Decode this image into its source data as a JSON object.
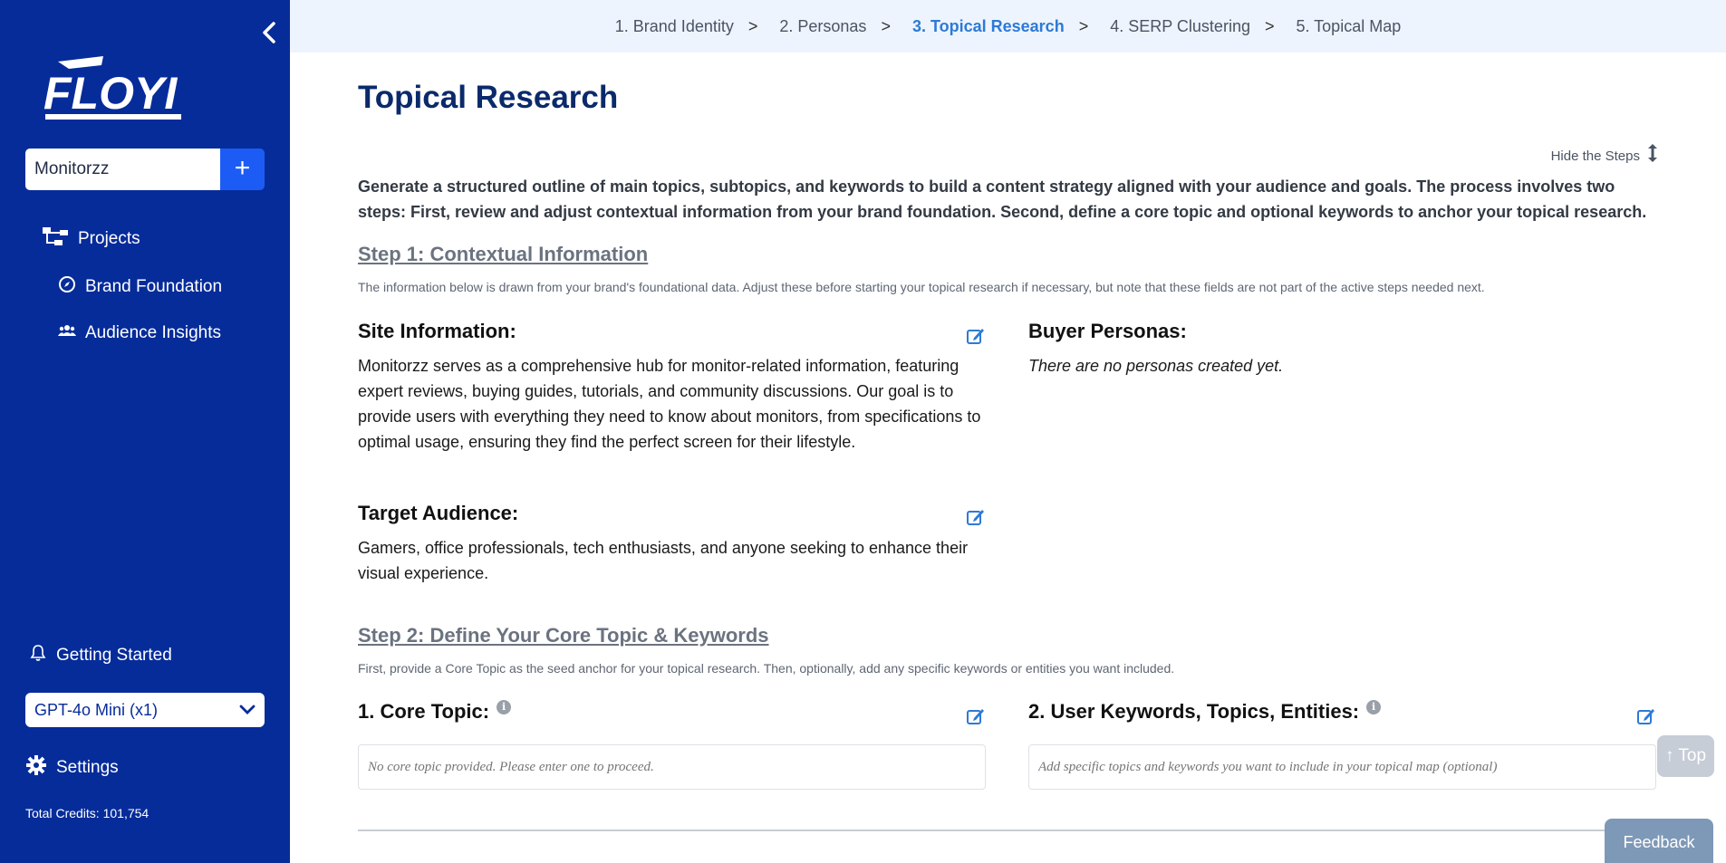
{
  "sidebar": {
    "logo_text": "FLOYI",
    "project_value": "Monitorzz",
    "nav": {
      "projects": "Projects",
      "brand_foundation": "Brand Foundation",
      "audience_insights": "Audience Insights",
      "getting_started": "Getting Started",
      "settings": "Settings"
    },
    "model_select": "GPT-4o Mini (x1)",
    "credits": "Total Credits: 101,754"
  },
  "stepper": {
    "steps": [
      {
        "label": "1. Brand Identity"
      },
      {
        "label": "2. Personas"
      },
      {
        "label": "3. Topical Research"
      },
      {
        "label": "4. SERP Clustering"
      },
      {
        "label": "5. Topical Map"
      }
    ],
    "separator": ">"
  },
  "main": {
    "title": "Topical Research",
    "hide_steps": "Hide the Steps",
    "intro": "Generate a structured outline of main topics, subtopics, and keywords to build a content strategy aligned with your audience and goals. The process involves two steps: First, review and adjust contextual information from your brand foundation. Second, define a core topic and optional keywords to anchor your topical research.",
    "step1": {
      "heading": "Step 1: Contextual Information",
      "desc": "The information below is drawn from your brand's foundational data. Adjust these before starting your topical research if necessary, but note that these fields are not part of the active steps needed next.",
      "site_info_title": "Site Information:",
      "site_info_body": "Monitorzz serves as a comprehensive hub for monitor-related information, featuring expert reviews, buying guides, tutorials, and community discussions. Our goal is to provide users with everything they need to know about monitors, from specifications to optimal usage, ensuring they find the perfect screen for their lifestyle.",
      "target_title": "Target Audience:",
      "target_body": "Gamers, office professionals, tech enthusiasts, and anyone seeking to enhance their visual experience.",
      "personas_title": "Buyer Personas:",
      "personas_body": "There are no personas created yet."
    },
    "step2": {
      "heading": "Step 2: Define Your Core Topic & Keywords",
      "desc": "First, provide a Core Topic as the seed anchor for your topical research. Then, optionally, add any specific keywords or entities you want included.",
      "core_title": "1. Core Topic:",
      "core_placeholder": "No core topic provided. Please enter one to proceed.",
      "keywords_title": "2. User Keywords, Topics, Entities:",
      "keywords_placeholder": "Add specific topics and keywords you want to include in your topical map (optional)"
    }
  },
  "floating": {
    "top": "↑ Top",
    "feedback": "Feedback"
  }
}
